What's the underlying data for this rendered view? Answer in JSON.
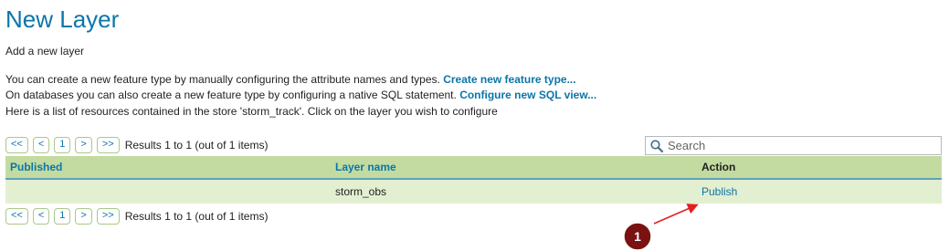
{
  "page": {
    "title": "New Layer",
    "subtitle": "Add a new layer"
  },
  "description": {
    "line1_text": "You can create a new feature type by manually configuring the attribute names and types. ",
    "line1_link": "Create new feature type...",
    "line2_text": "On databases you can also create a new feature type by configuring a native SQL statement. ",
    "line2_link": "Configure new SQL view...",
    "line3_text": "Here is a list of resources contained in the store 'storm_track'. Click on the layer you wish to configure"
  },
  "pager": {
    "first": "<<",
    "prev": "<",
    "page": "1",
    "next": ">",
    "last": ">>",
    "info": "Results 1 to 1 (out of 1 items)"
  },
  "search": {
    "placeholder": "Search",
    "icon": "magnifier-icon"
  },
  "table": {
    "headers": {
      "published": "Published",
      "layer_name": "Layer name",
      "action": "Action"
    },
    "rows": [
      {
        "published": "",
        "layer_name": "storm_obs",
        "action": "Publish"
      }
    ]
  },
  "annotation": {
    "number": "1",
    "badge_color": "#7a1212",
    "arrow_color": "#e02020"
  },
  "colors": {
    "link": "#0b76a8",
    "header_bg": "#c3dba0",
    "row_bg": "#e3efd1",
    "header_border": "#5fa2b8"
  }
}
